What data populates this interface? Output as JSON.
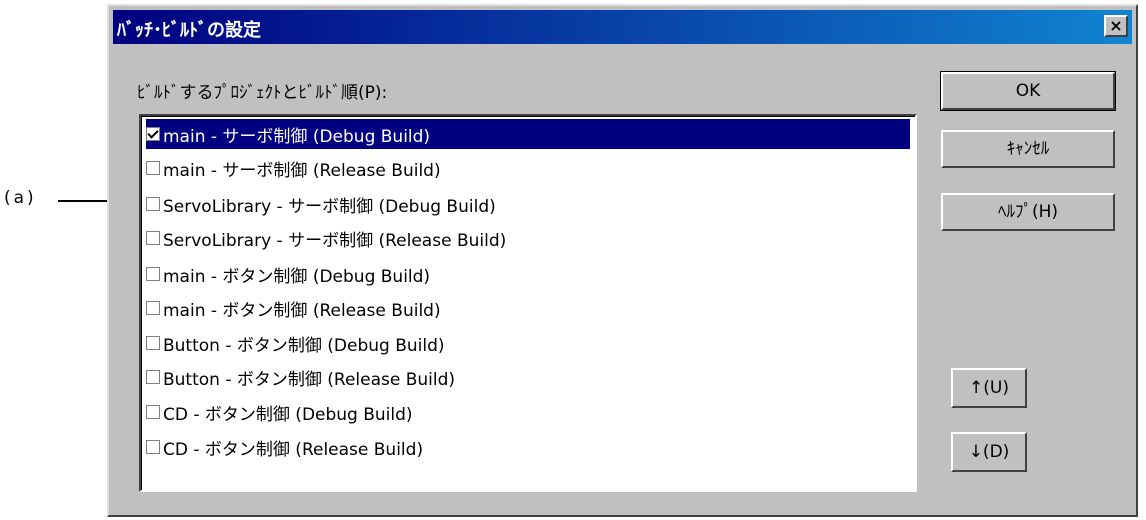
{
  "annotation": {
    "label": "(a)"
  },
  "dialog": {
    "title": "ﾊﾞｯﾁ･ﾋﾞﾙﾄﾞの設定",
    "close_label": "×",
    "list_label": "ﾋﾞﾙﾄﾞするﾌﾟﾛｼﾞｪｸﾄとﾋﾞﾙﾄﾞ順(P):",
    "items": [
      {
        "label": "main - サーボ制御 (Debug Build)",
        "checked": true,
        "selected": true
      },
      {
        "label": "main - サーボ制御 (Release Build)",
        "checked": false,
        "selected": false
      },
      {
        "label": "ServoLibrary - サーボ制御 (Debug Build)",
        "checked": false,
        "selected": false
      },
      {
        "label": "ServoLibrary - サーボ制御 (Release Build)",
        "checked": false,
        "selected": false
      },
      {
        "label": "main - ボタン制御 (Debug Build)",
        "checked": false,
        "selected": false
      },
      {
        "label": "main - ボタン制御 (Release Build)",
        "checked": false,
        "selected": false
      },
      {
        "label": "Button - ボタン制御 (Debug Build)",
        "checked": false,
        "selected": false
      },
      {
        "label": "Button - ボタン制御 (Release Build)",
        "checked": false,
        "selected": false
      },
      {
        "label": "CD - ボタン制御 (Debug Build)",
        "checked": false,
        "selected": false
      },
      {
        "label": "CD - ボタン制御 (Release Build)",
        "checked": false,
        "selected": false
      }
    ],
    "buttons": {
      "ok": "OK",
      "cancel": "ｷｬﾝｾﾙ",
      "help": "ﾍﾙﾌﾟ(H)",
      "up": "↑(U)",
      "down": "↓(D)"
    }
  }
}
